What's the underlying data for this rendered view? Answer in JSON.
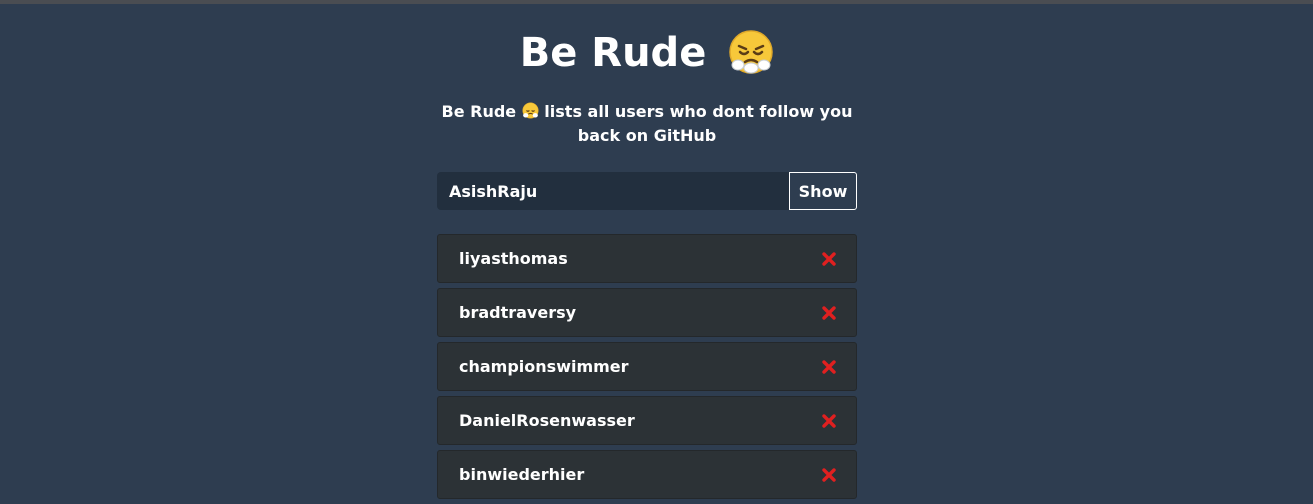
{
  "header": {
    "title": "Be Rude",
    "title_emoji": "face-with-steam-from-nose-icon",
    "subtitle_pre": "Be Rude",
    "subtitle_post": "lists all users who dont follow you back on GitHub"
  },
  "search": {
    "value": "AsishRaju",
    "button_label": "Show"
  },
  "users": [
    {
      "name": "liyasthomas"
    },
    {
      "name": "bradtraversy"
    },
    {
      "name": "championswimmer"
    },
    {
      "name": "DanielRosenwasser"
    },
    {
      "name": "binwiederhier"
    }
  ],
  "colors": {
    "background": "#2e3d50",
    "input_bg": "#222f3e",
    "row_bg": "#2c3236",
    "remove": "#e02020",
    "emoji_face": "#f7c83a"
  }
}
